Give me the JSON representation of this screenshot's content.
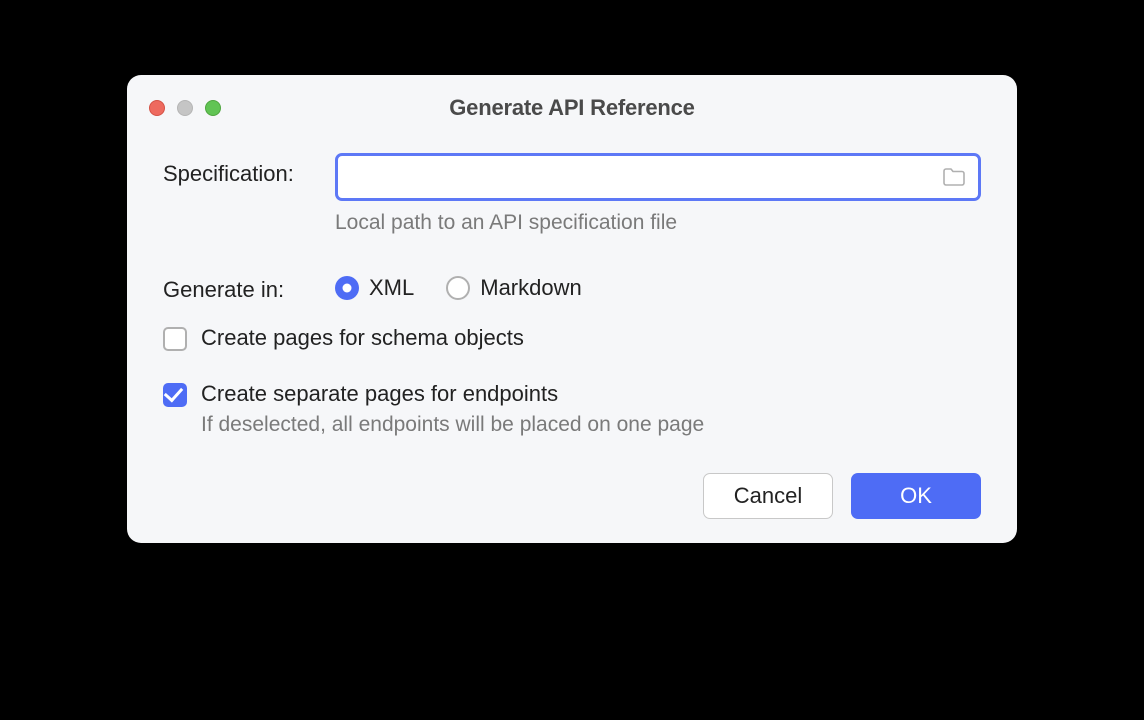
{
  "dialog": {
    "title": "Generate API Reference",
    "specification": {
      "label": "Specification:",
      "value": "",
      "hint": "Local path to an API specification file"
    },
    "generateIn": {
      "label": "Generate in:",
      "options": {
        "xml": "XML",
        "markdown": "Markdown"
      },
      "selected": "xml"
    },
    "checkboxes": {
      "schemaPages": {
        "label": "Create pages for schema objects",
        "checked": false
      },
      "endpointPages": {
        "label": "Create separate pages for endpoints",
        "sub": "If deselected, all endpoints will be placed on one page",
        "checked": true
      }
    },
    "buttons": {
      "cancel": "Cancel",
      "ok": "OK"
    }
  }
}
